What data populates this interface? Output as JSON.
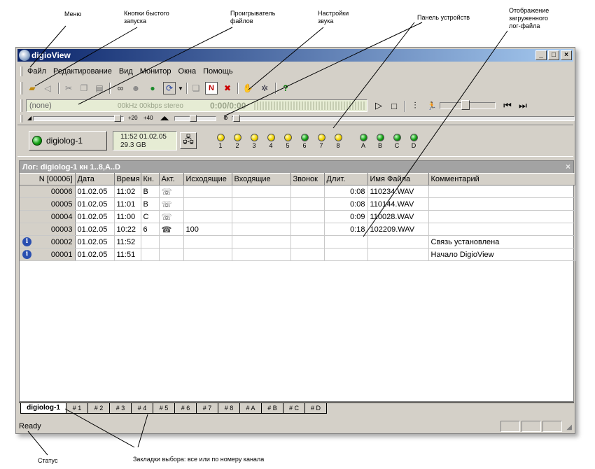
{
  "callouts": {
    "menu": "Меню",
    "quick": "Кнопки быстого\nзапуска",
    "player": "Проигрыватель\nфайлов",
    "sound": "Настройки\nзвука",
    "devices": "Панель устройств",
    "logfile": "Отображение\nзагруженного\nлог-файла",
    "status": "Статус",
    "tabs": "Закладки выбора: все или по номеру канала"
  },
  "window": {
    "title": "digioView",
    "controls": [
      "_",
      "□",
      "×"
    ]
  },
  "menu": [
    "Файл",
    "Редактирование",
    "Вид",
    "Монитор",
    "Окна",
    "Помощь"
  ],
  "toolbar_icons": [
    "open-folder-icon",
    "speaker-icon",
    "cut-icon",
    "copy-icon",
    "paste-icon",
    "binoculars-icon",
    "find-user-icon",
    "globe-icon",
    "refresh-icon",
    "dropdown-arrow-icon",
    "copy-doc-icon",
    "new-doc-icon",
    "delete-doc-icon",
    "hand-icon",
    "settings-icon",
    "help-icon"
  ],
  "player": {
    "file": "(none)",
    "format": "00kHz 00kbps stereo",
    "time": "0:00/0:00",
    "vu_scale": "-70  -63  -56  -49  -42  -35  -28  -21  -14  -7"
  },
  "sound": {
    "gain_left": "+20",
    "gain_right": "+40"
  },
  "device": {
    "name": "digiolog-1",
    "time": "11:52  01.02.05",
    "storage": "29.3 GB",
    "channels": [
      {
        "label": "1",
        "color": "y"
      },
      {
        "label": "2",
        "color": "y"
      },
      {
        "label": "3",
        "color": "y"
      },
      {
        "label": "4",
        "color": "y"
      },
      {
        "label": "5",
        "color": "y"
      },
      {
        "label": "6",
        "color": "g"
      },
      {
        "label": "7",
        "color": "y"
      },
      {
        "label": "8",
        "color": "y"
      },
      {
        "label": "A",
        "color": "g"
      },
      {
        "label": "B",
        "color": "g"
      },
      {
        "label": "C",
        "color": "g"
      },
      {
        "label": "D",
        "color": "g"
      }
    ]
  },
  "log": {
    "title": "Лог:  digiolog-1  кн 1..8,A..D",
    "close": "×",
    "columns": [
      "N [00006]",
      "Дата",
      "Время",
      "Кн.",
      "Акт.",
      "Исходящие",
      "Входящие",
      "Звонок",
      "Длит.",
      "Имя Файла",
      "Комментарий"
    ],
    "rows": [
      {
        "n": "00006",
        "info": false,
        "date": "01.02.05",
        "time": "11:02",
        "ch": "B",
        "act": "☏",
        "out": "",
        "in": "",
        "ring": "",
        "dur": "0:08",
        "file": "110234.WAV",
        "comment": ""
      },
      {
        "n": "00005",
        "info": false,
        "date": "01.02.05",
        "time": "11:01",
        "ch": "B",
        "act": "☏",
        "out": "",
        "in": "",
        "ring": "",
        "dur": "0:08",
        "file": "110144.WAV",
        "comment": ""
      },
      {
        "n": "00004",
        "info": false,
        "date": "01.02.05",
        "time": "11:00",
        "ch": "C",
        "act": "☏",
        "out": "",
        "in": "",
        "ring": "",
        "dur": "0:09",
        "file": "110028.WAV",
        "comment": ""
      },
      {
        "n": "00003",
        "info": false,
        "date": "01.02.05",
        "time": "10:22",
        "ch": "6",
        "act": "☎",
        "out": "100",
        "in": "",
        "ring": "",
        "dur": "0:18",
        "file": "102209.WAV",
        "comment": ""
      },
      {
        "n": "00002",
        "info": true,
        "date": "01.02.05",
        "time": "11:52",
        "ch": "",
        "act": "",
        "out": "",
        "in": "",
        "ring": "",
        "dur": "",
        "file": "",
        "comment": "Связь установлена"
      },
      {
        "n": "00001",
        "info": true,
        "date": "01.02.05",
        "time": "11:51",
        "ch": "",
        "act": "",
        "out": "",
        "in": "",
        "ring": "",
        "dur": "",
        "file": "",
        "comment": "Начало DigioView"
      }
    ]
  },
  "tabs": [
    "digiolog-1",
    "# 1",
    "# 2",
    "# 3",
    "# 4",
    "# 5",
    "# 6",
    "# 7",
    "# 8",
    "# A",
    "# B",
    "# C",
    "# D"
  ],
  "status": "Ready"
}
